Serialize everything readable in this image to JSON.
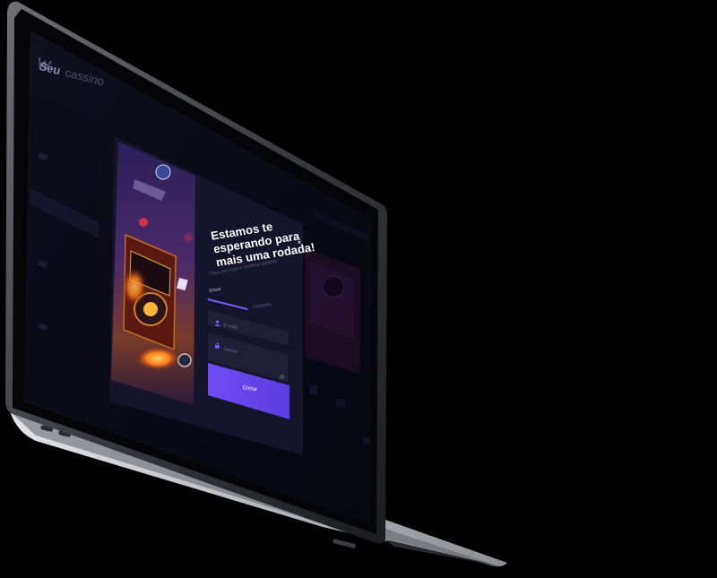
{
  "app": {
    "brand_bold": "Seu",
    "brand_light": "cassino"
  },
  "modal": {
    "title": "Estamos te esperando para mais uma rodada!",
    "subtitle": "Faça seu login e continue jogando",
    "close_symbol": "×",
    "tabs": [
      "Entrar",
      "Cadastro"
    ],
    "email_placeholder": "E-mail",
    "password_placeholder": "Senha",
    "submit_label": "Entrar"
  },
  "colors": {
    "accent": "#6c4cf0",
    "modal_bg": "#15162a",
    "input_bg": "#1f2038",
    "page_bg": "#0b0b18"
  },
  "icons": {
    "close": "close-icon",
    "email": "user-icon",
    "password": "lock-icon",
    "show_password": "eye-icon",
    "logo": "logo-icon"
  }
}
